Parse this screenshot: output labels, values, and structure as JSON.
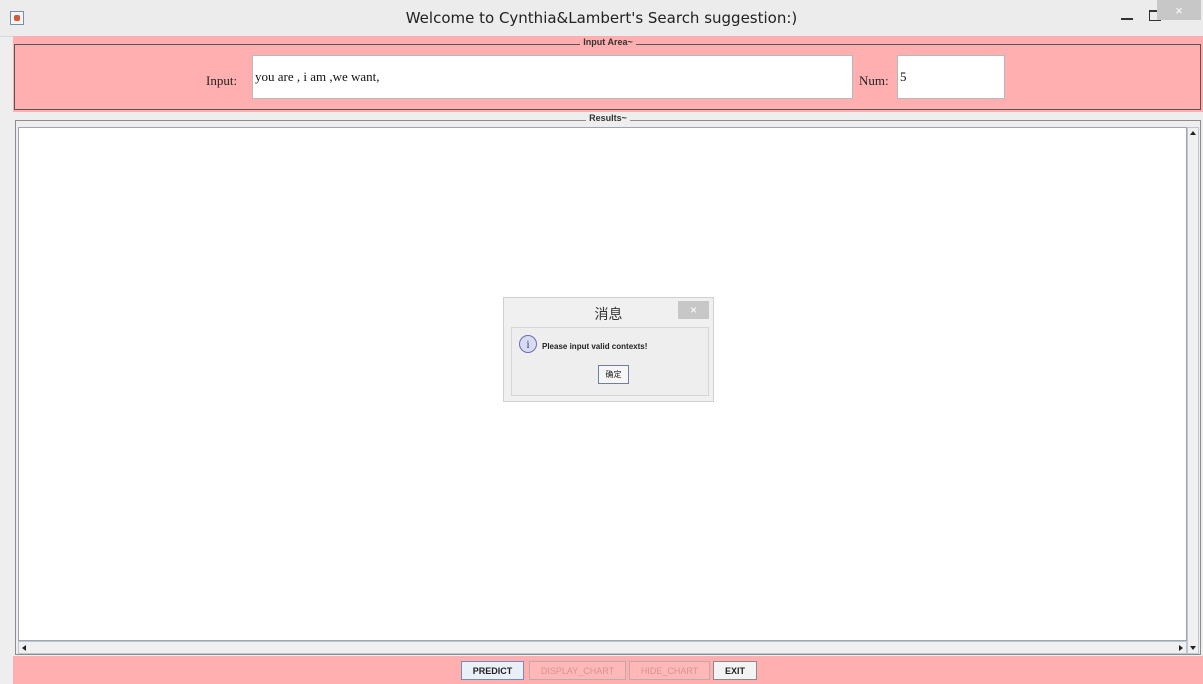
{
  "window": {
    "title": "Welcome to Cynthia&Lambert's Search suggestion:)",
    "minimize_glyph": "",
    "maximize_glyph": "",
    "close_glyph": "×"
  },
  "input_area": {
    "title": "Input Area~",
    "input_label": "Input:",
    "input_value": "you are , i am ,we want,",
    "num_label": "Num:",
    "num_value": "5"
  },
  "results": {
    "title": "Results~",
    "content": ""
  },
  "buttons": {
    "predict": "PREDICT",
    "display_chart": "DISPLAY_CHART",
    "hide_chart": "HIDE_CHART",
    "exit": "EXIT"
  },
  "dialog": {
    "title": "消息",
    "close_glyph": "×",
    "icon_glyph": "i",
    "message": "Please input valid contexts!",
    "ok_label": "确定"
  }
}
